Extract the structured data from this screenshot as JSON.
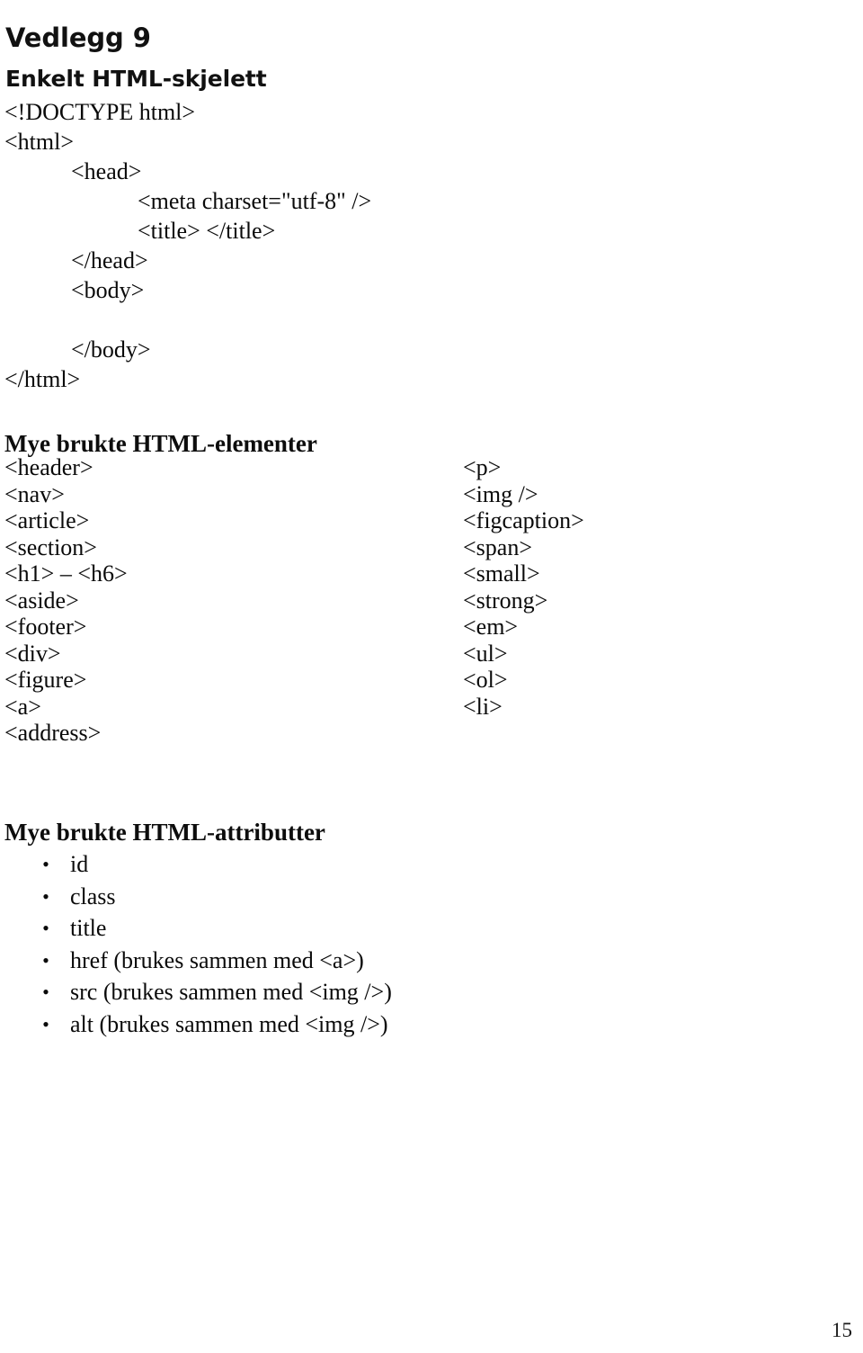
{
  "document": {
    "title": "Vedlegg 9",
    "subtitle": "Enkelt HTML-skjelett",
    "page_number": "15"
  },
  "code_skeleton": {
    "lines": [
      {
        "text": "<!DOCTYPE html>",
        "indent": 0
      },
      {
        "text": "<html>",
        "indent": 0
      },
      {
        "text": "<head>",
        "indent": 1
      },
      {
        "text": "<meta charset=\"utf-8\" />",
        "indent": 2
      },
      {
        "text": "<title> </title>",
        "indent": 2
      },
      {
        "text": "</head>",
        "indent": 1
      },
      {
        "text": "<body>",
        "indent": 1
      },
      {
        "text": " ",
        "indent": 1
      },
      {
        "text": "</body>",
        "indent": 1
      },
      {
        "text": "</html>",
        "indent": 0
      }
    ]
  },
  "elements_section": {
    "heading": "Mye brukte HTML-elementer",
    "left_column": [
      "<header>",
      "<nav>",
      "<article>",
      "<section>",
      "<h1> – <h6>",
      "<aside>",
      "<footer>",
      "<div>",
      "<figure>",
      "<a>",
      "<address>"
    ],
    "right_column": [
      "<p>",
      "<img />",
      "<figcaption>",
      "<span>",
      "<small>",
      "<strong>",
      "<em>",
      "<ul>",
      "<ol>",
      "<li>"
    ]
  },
  "attributes_section": {
    "heading": "Mye brukte HTML-attributter",
    "bullet_glyph": "•",
    "items": [
      "id",
      "class",
      "title",
      "href (brukes sammen med <a>)",
      "src (brukes sammen med <img />)",
      "alt (brukes sammen med <img />)"
    ]
  }
}
